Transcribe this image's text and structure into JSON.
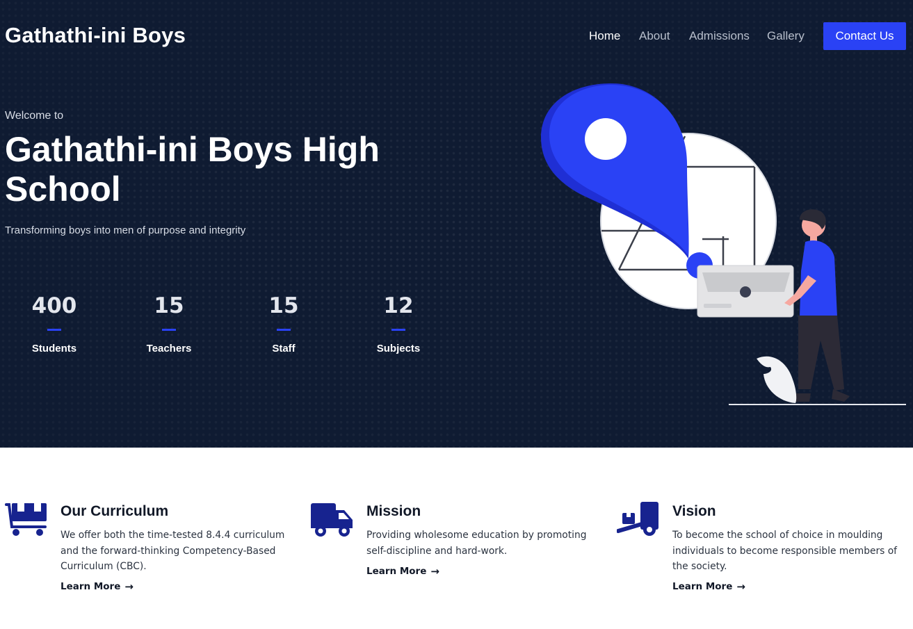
{
  "header": {
    "logo": "Gathathi-ini Boys",
    "nav": [
      {
        "label": "Home",
        "active": true
      },
      {
        "label": "About",
        "active": false
      },
      {
        "label": "Admissions",
        "active": false
      },
      {
        "label": "Gallery",
        "active": false
      }
    ],
    "contact_label": "Contact Us"
  },
  "hero": {
    "welcome": "Welcome to",
    "title": "Gathathi-ini Boys High School",
    "tagline": "Transforming boys into men of purpose and integrity",
    "stats": [
      {
        "value": "400",
        "label": "Students"
      },
      {
        "value": "15",
        "label": "Teachers"
      },
      {
        "value": "15",
        "label": "Staff"
      },
      {
        "value": "12",
        "label": "Subjects"
      }
    ]
  },
  "features": [
    {
      "icon": "dolly-box-icon",
      "title": "Our Curriculum",
      "description": "We offer both the time-tested 8.4.4 curriculum and the forward-thinking Competency-Based Curriculum (CBC).",
      "link": "Learn More"
    },
    {
      "icon": "truck-icon",
      "title": "Mission",
      "description": "Providing wholesome education by promoting self-discipline and hard-work.",
      "link": "Learn More"
    },
    {
      "icon": "hand-truck-icon",
      "title": "Vision",
      "description": "To become the school of choice in moulding individuals to become responsible members of the society.",
      "link": "Learn More"
    }
  ],
  "colors": {
    "hero_bg": "#0f1b32",
    "accent": "#2a42f5",
    "icon_navy": "#17238f"
  }
}
